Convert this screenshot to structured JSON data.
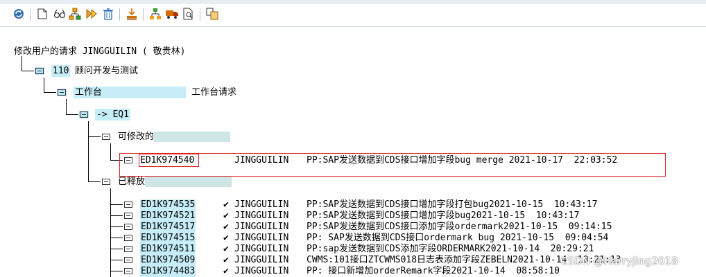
{
  "toolbar": {
    "icons": [
      "refresh-icon",
      "new-document-icon",
      "glasses-icon",
      "hierarchy-icon",
      "release-icon",
      "delete-icon",
      "import-icon",
      "org-icon",
      "truck-icon",
      "document-search-icon",
      "copy-icon"
    ]
  },
  "tree": {
    "title": "修改用户的请求 JINGGUILIN ( 敬贵林)",
    "client": {
      "code": "110",
      "desc": "顾问开发与测试"
    },
    "workbench": {
      "label": "工作台",
      "desc": "工作台请求"
    },
    "target": {
      "label": "-> EQ1"
    },
    "modifiable": {
      "label": "可修改的",
      "items": [
        {
          "id": "ED1K974540",
          "check": "",
          "owner": "JINGGUILIN",
          "text": "PP:SAP发送数据到CDS接口增加字段bug merge 2021-10-17  22:03:52"
        }
      ]
    },
    "released": {
      "label": "已释放",
      "items": [
        {
          "id": "ED1K974535",
          "check": "✔",
          "owner": "JINGGUILIN",
          "text": "PP:SAP发送数据到CDS接口增加字段打包bug2021-10-15  10:43:17"
        },
        {
          "id": "ED1K974521",
          "check": "✔",
          "owner": "JINGGUILIN",
          "text": "PP:SAP发送数据到CDS接口增加字段bug2021-10-15  10:43:17"
        },
        {
          "id": "ED1K974517",
          "check": "✔",
          "owner": "JINGGUILIN",
          "text": "PP:SAP发送数据到CDS接口添加字段ordermark2021-10-15  09:14:15"
        },
        {
          "id": "ED1K974515",
          "check": "✔",
          "owner": "JINGGUILIN",
          "text": "PP: SAP发送数据到CDS接口ordermark bug 2021-10-15  09:04:54"
        },
        {
          "id": "ED1K974511",
          "check": "✔",
          "owner": "JINGGUILIN",
          "text": "PP:sap发送数据到CDS添加字段ORDERMARK2021-10-14  20:29:21"
        },
        {
          "id": "ED1K974509",
          "check": "✔",
          "owner": "JINGGUILIN",
          "text": "CWMS:101接口ZTCWMS018日志表添加字段ZEBELN2021-10-14  10:21:13"
        },
        {
          "id": "ED1K974483",
          "check": "✔",
          "owner": "JINGGUILIN",
          "text": "PP: 接口新增加orderRemark字段2021-10-14  08:58:10"
        }
      ]
    }
  },
  "watermark": "CSDN @Harryjing2018"
}
